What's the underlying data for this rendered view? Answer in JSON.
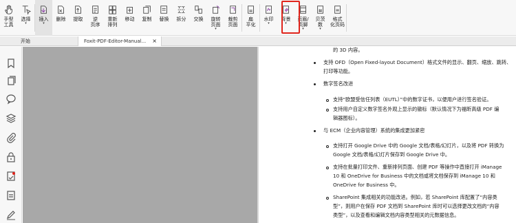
{
  "ribbon": {
    "buttons": [
      {
        "label": "手型\n工具",
        "icon": "hand-icon",
        "caret": false
      },
      {
        "label": "选择",
        "icon": "select-cursor-icon",
        "caret": true
      },
      {
        "label": "插入",
        "icon": "insert-page-icon",
        "caret": true,
        "active": true
      },
      {
        "label": "删除",
        "icon": "delete-page-icon",
        "caret": false
      },
      {
        "label": "提取",
        "icon": "extract-page-icon",
        "caret": false
      },
      {
        "label": "逆\n页序",
        "icon": "reverse-order-icon",
        "caret": false
      },
      {
        "label": "重新\n排列",
        "icon": "rearrange-icon",
        "caret": false
      },
      {
        "label": "移动",
        "icon": "move-page-icon",
        "caret": false
      },
      {
        "label": "复制",
        "icon": "copy-page-icon",
        "caret": false
      },
      {
        "label": "替换",
        "icon": "replace-page-icon",
        "caret": false
      },
      {
        "label": "拆分",
        "icon": "split-icon",
        "caret": false
      },
      {
        "label": "交换",
        "icon": "swap-icon",
        "caret": false
      },
      {
        "label": "旋转\n页面",
        "icon": "rotate-page-icon",
        "caret": true
      },
      {
        "label": "裁剪\n页面",
        "icon": "crop-page-icon",
        "caret": false
      },
      {
        "label": "扁\n平化",
        "icon": "flatten-icon",
        "caret": false
      },
      {
        "label": "水印",
        "icon": "watermark-icon",
        "caret": true
      },
      {
        "label": "背景",
        "icon": "background-icon",
        "caret": true
      },
      {
        "label": "页眉/\n页脚",
        "icon": "header-footer-icon",
        "caret": true
      },
      {
        "label": "贝茨\n数",
        "icon": "bates-number-icon",
        "caret": true
      },
      {
        "label": "格式\n化页码",
        "icon": "format-page-number-icon",
        "caret": false
      }
    ]
  },
  "tabs": {
    "home": "开始",
    "doc": "Foxit-PDF-Editor-Manual...",
    "close": "×"
  },
  "doc": {
    "l1": "的 3D 内容。",
    "l2": "支持 OFD（Open Fixed-layout Document）格式文件的显示、翻页、缩放、跳转、",
    "l3": "打印等功能。",
    "l4": "数字签名改进",
    "l5": "支持“欧盟受信任列表（EUTL）”中的数字证书，以便用户进行签名验证。",
    "l6": "支持用户自定义数字签名外观上显示的徽标（默认情况下为福昕高级 PDF 编",
    "l7": "辑器图标）。",
    "l8": "与 ECM（企业内容管理）系统的集成更加紧密",
    "l9": "支持打开 Google Drive 中的 Google 文档/表格/幻灯片，以及将 PDF 转换为",
    "l10": "Google 文档/表格/幻灯片保存到 Google Drive 中。",
    "l11": "支持在批量打印文件、重新排列页面、创建 PDF 等操作中直接打开 iManage",
    "l12": "10 和 OneDrive for Business 中的文档或将文档保存到 iManage 10 和",
    "l13": "OneDrive for Business 中。",
    "l14": "SharePoint 集成相关的功能改进。例如，若 SharePoint 库配置了“内容类",
    "l15": "型”，则用户在保存 PDF 文档到 SharePoint 库时可以选择更改文档的“内容",
    "l16": "类型”，以及查看和编辑文档内容类型相关的元数据信息。"
  },
  "left_panel": [
    "bookmark-icon",
    "pages-icon",
    "comment-icon",
    "layers-icon",
    "attachment-icon",
    "security-icon",
    "signature-panel-icon",
    "document-info-icon",
    "sign-icon"
  ],
  "colors": {
    "highlight": "#e0241b",
    "page_gray": "#a8a8a8"
  }
}
